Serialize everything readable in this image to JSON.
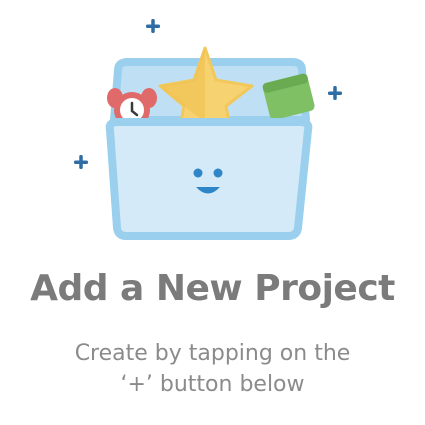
{
  "empty_state": {
    "title": "Add a New Project",
    "subtitle_line1": "Create by tapping on the",
    "subtitle_line2": "‘+’ button below"
  },
  "illustration": {
    "icons": [
      "basket-icon",
      "alarm-clock-icon",
      "star-icon",
      "ticket-icon",
      "plus-icon",
      "face-icon"
    ],
    "colors": {
      "basket_front": "#d4eaf8",
      "basket_rim": "#9bcfee",
      "basket_back": "#bfe0f4",
      "star": "#f7d270",
      "star_shade": "#eec04f",
      "ticket": "#7fc064",
      "clock": "#e06a6a",
      "plus": "#2e6da4",
      "face": "#2e86c8"
    }
  }
}
